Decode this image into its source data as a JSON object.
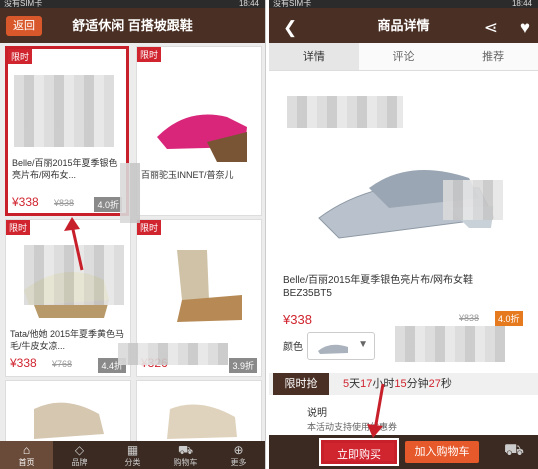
{
  "left": {
    "status_left": "没有SIM卡",
    "status_time": "18:44",
    "back_label": "返回",
    "title": "舒适休闲 百搭坡跟鞋",
    "products": [
      {
        "tag": "限时",
        "name": "Belle/百丽2015年夏季银色亮片布/网布女...",
        "price": "¥338",
        "orig": "¥838",
        "disc": "4.0折"
      },
      {
        "tag": "限时",
        "name": "百丽驼玉INNET/普奈儿",
        "price": "",
        "orig": "",
        "disc": ""
      },
      {
        "tag": "限时",
        "name": "Tata/他她 2015年夏季黄色马毛/牛皮女凉...",
        "price": "¥338",
        "orig": "¥768",
        "disc": "4.4折"
      },
      {
        "tag": "限时",
        "name": "",
        "price": "¥326",
        "orig": "",
        "disc": "3.9折"
      },
      {
        "tag": "",
        "name": "",
        "price": "",
        "orig": "",
        "disc": ""
      },
      {
        "tag": "",
        "name": "",
        "price": "",
        "orig": "",
        "disc": ""
      }
    ],
    "nav": [
      {
        "icon": "⌂",
        "label": "首页"
      },
      {
        "icon": "◇",
        "label": "品牌"
      },
      {
        "icon": "▦",
        "label": "分类"
      },
      {
        "icon": "⛟",
        "label": "购物车"
      },
      {
        "icon": "⊕",
        "label": "更多"
      }
    ]
  },
  "right": {
    "status_left": "没有SIM卡",
    "status_time": "18:44",
    "title": "商品详情",
    "tabs": [
      "详情",
      "评论",
      "推荐"
    ],
    "product_name": "Belle/百丽2015年夏季银色亮片布/网布女鞋BEZ35BT5",
    "price": "¥338",
    "orig": "¥838",
    "disc": "4.0折",
    "color_label": "颜色",
    "flash_label": "限时抢",
    "countdown": {
      "d": "5",
      "d_unit": "天",
      "h": "17",
      "h_unit": "小时",
      "m": "15",
      "m_unit": "分钟",
      "s": "27",
      "s_unit": "秒"
    },
    "desc_title": "说明",
    "desc_text": "本活动支持使用优惠券",
    "buy_now": "立即购买",
    "add_cart": "加入购物车"
  }
}
